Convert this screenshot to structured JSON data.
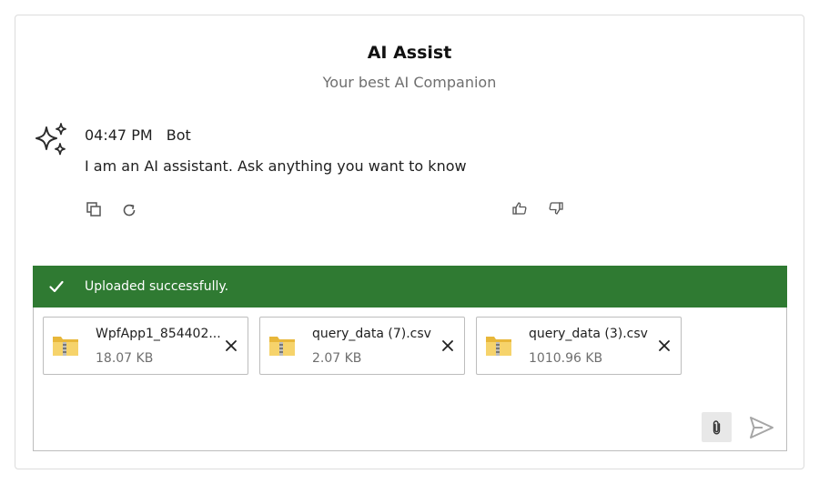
{
  "header": {
    "title": "AI Assist",
    "subtitle": "Your best AI Companion"
  },
  "message": {
    "time": "04:47 PM",
    "sender": "Bot",
    "text": "I am an AI assistant. Ask anything you want to know",
    "avatar_icon": "sparkles-icon",
    "actions": [
      "copy-icon",
      "regenerate-icon",
      "thumbs-up-icon",
      "thumbs-down-icon"
    ]
  },
  "upload_status": {
    "text": "Uploaded successfully.",
    "color": "#2f7a32",
    "icon": "check-icon"
  },
  "attachments": [
    {
      "name": "WpfApp1_854402...",
      "size": "18.07  KB",
      "icon": "zip-folder-icon"
    },
    {
      "name": "query_data (7).csv",
      "size": "2.07  KB",
      "icon": "zip-folder-icon"
    },
    {
      "name": "query_data (3).csv",
      "size": "1010.96  KB",
      "icon": "zip-folder-icon"
    }
  ],
  "composer": {
    "attach_icon": "paperclip-icon",
    "send_icon": "send-icon"
  }
}
